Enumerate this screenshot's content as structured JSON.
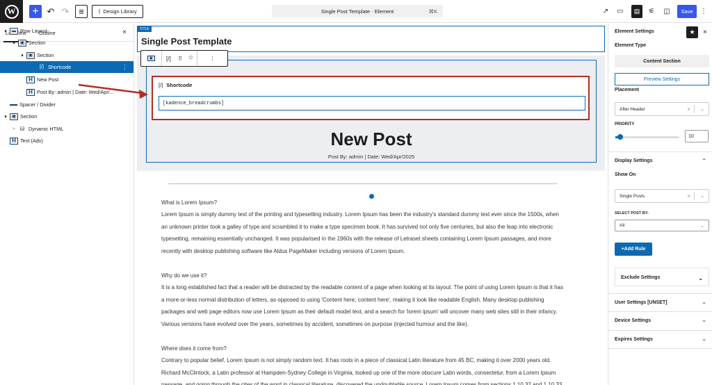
{
  "topbar": {
    "logo": "W",
    "add_icon": "+",
    "undo_icon": "↶",
    "redo_icon": "↷",
    "list_icon": "≡",
    "design_library_label": "Design Library",
    "document_title": "Single Post Template · Element",
    "shortcut": "⌘K",
    "save_label": "Save"
  },
  "left_panel": {
    "tabs": [
      "List View",
      "Outline"
    ],
    "close": "×",
    "tree": [
      {
        "label": "Row Layout",
        "icon": "row-layout-icon",
        "glyph": "▬"
      },
      {
        "label": "Section",
        "icon": "section-icon",
        "glyph": "▣"
      },
      {
        "label": "Section",
        "icon": "section-icon",
        "glyph": "▣"
      },
      {
        "label": "Shortcode",
        "icon": "shortcode-icon",
        "glyph": "[/]"
      },
      {
        "label": "New Post",
        "icon": "heading-icon",
        "glyph": "H"
      },
      {
        "label": "Post By: admin | Date: Wed/Apr/...",
        "icon": "heading-icon",
        "glyph": "H"
      },
      {
        "label": "Spacer / Divider",
        "icon": "divider-icon",
        "glyph": ""
      },
      {
        "label": "Section",
        "icon": "section-icon",
        "glyph": "▣"
      },
      {
        "label": "Dynamic HTML",
        "icon": "database-icon",
        "glyph": "⛁"
      },
      {
        "label": "Text (Adv)",
        "icon": "heading-icon",
        "glyph": "H"
      }
    ]
  },
  "canvas": {
    "title_tag": "TITLE",
    "page_title": "Single Post Template",
    "toolbar_glyph": "[/]",
    "shortcode_label": "Shortcode",
    "shortcode_value": "[kadence_breadcrumbs]",
    "post_title": "New Post",
    "post_meta": "Post By: admin | Date: Wed/Apr/2025",
    "paragraphs": [
      "What is Lorem Ipsum?",
      "Lorem Ipsum is simply dummy text of the printing and typesetting industry. Lorem Ipsum has been the industry's standard dummy text ever since the 1500s, when an unknown printer took a galley of type and scrambled it to make a type specimen book. It has survived not only five centuries, but also the leap into electronic typesetting, remaining essentially unchanged. It was popularised in the 1960s with the release of Letraset sheets containing Lorem Ipsum passages, and more recently with desktop publishing software like Aldus PageMaker including versions of Lorem Ipsum.",
      "Why do we use it?",
      "It is a long established fact that a reader will be distracted by the readable content of a page when looking at its layout. The point of using Lorem Ipsum is that it has a more-or-less normal distribution of letters, as opposed to using 'Content here, content here', making it look like readable English. Many desktop publishing packages and web page editors now use Lorem Ipsum as their default model text, and a search for 'lorem ipsum' will uncover many web sites still in their infancy. Various versions have evolved over the years, sometimes by accident, sometimes on purpose (injected humour and the like).",
      "Where does it come from?",
      "Contrary to popular belief, Lorem Ipsum is not simply random text. It has roots in a piece of classical Latin literature from 45 BC, making it over 2000 years old. Richard McClintock, a Latin professor at Hampden-Sydney College in Virginia, looked up one of the more obscure Latin words, consectetur, from a Lorem Ipsum passage, and going through the cites of the word in classical literature, discovered the undoubtable source. Lorem Ipsum comes from sections 1.10.32 and 1.10.33 of"
    ]
  },
  "right_panel": {
    "title": "Element Settings",
    "star": "★",
    "close": "×",
    "element_type_label": "Element Type",
    "element_type_value": "Content Section",
    "preview_label": "Preview Settings",
    "placement_label": "Placement",
    "placement_value": "After Header",
    "priority_label": "PRIORITY",
    "priority_value": "10",
    "priority_level": 0.08,
    "display_settings_label": "Display Settings",
    "show_on_label": "Show On",
    "show_on_value": "Single Posts",
    "select_post_by_label": "SELECT POST BY:",
    "select_post_by_value": "All",
    "add_rule_label": "Add Rule",
    "exclude_label": "Exclude Settings",
    "user_settings_label": "User Settings [UNSET]",
    "device_settings_label": "Device Settings",
    "expires_settings_label": "Expires Settings"
  },
  "colors": {
    "accent": "#0b6ab3",
    "annotation": "#b32d1e",
    "wp_blue": "#3858e9"
  }
}
